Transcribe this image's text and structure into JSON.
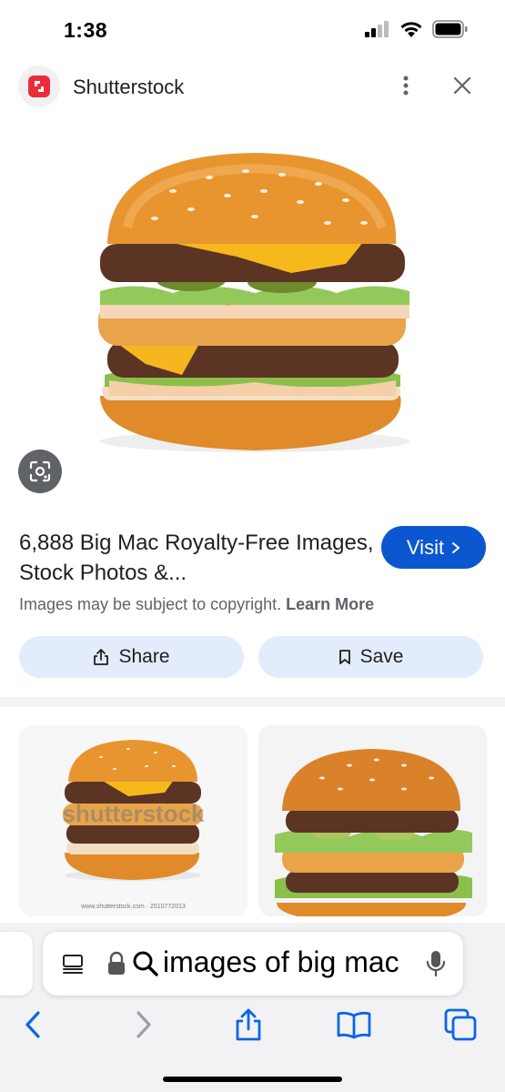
{
  "status_bar": {
    "time": "1:38"
  },
  "source": {
    "name": "Shutterstock"
  },
  "result": {
    "title": "6,888 Big Mac Royalty-Free Images, Stock Photos &...",
    "visit_label": "Visit",
    "copyright_text": "Images may be subject to copyright.",
    "learn_more_label": "Learn More",
    "share_label": "Share",
    "save_label": "Save"
  },
  "related": [
    {
      "watermark": "shutterstock",
      "caption": "www.shutterstock.com · 2510772013"
    },
    {
      "watermark": "",
      "caption": ""
    }
  ],
  "browser": {
    "address_text": "images of big mac"
  },
  "colors": {
    "accent": "#0b57d0",
    "chip_bg": "#e3ecfb",
    "brand": "#ee2b3b"
  },
  "icons": [
    "signal-icon",
    "wifi-icon",
    "battery-icon",
    "more-vert-icon",
    "close-icon",
    "lens-icon",
    "chevron-right-icon",
    "share-icon",
    "bookmark-icon",
    "reader-icon",
    "lock-icon",
    "search-icon",
    "mic-icon",
    "back-icon",
    "forward-icon",
    "share-sheet-icon",
    "bookmarks-icon",
    "tabs-icon"
  ]
}
